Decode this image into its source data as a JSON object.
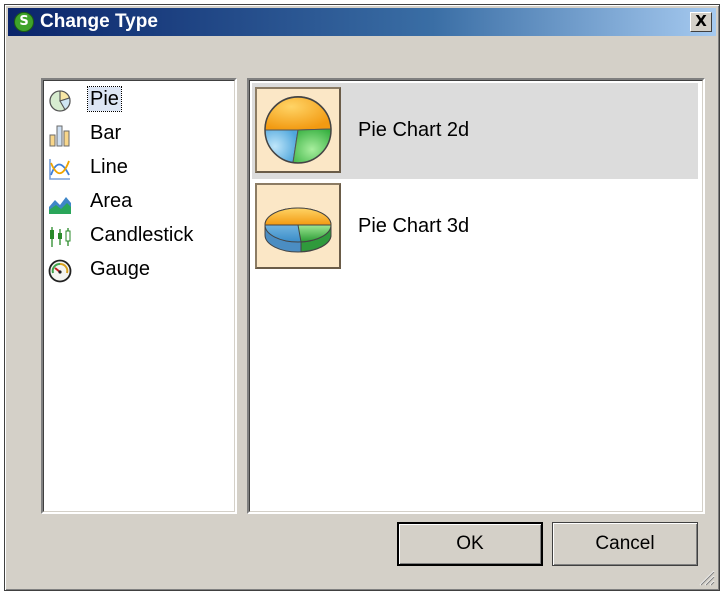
{
  "dialog": {
    "title": "Change Type",
    "close_glyph": "X",
    "app_icon_glyph": "S"
  },
  "chart_types": [
    {
      "label": "Pie",
      "icon": "pie-icon",
      "selected": true
    },
    {
      "label": "Bar",
      "icon": "bar-icon"
    },
    {
      "label": "Line",
      "icon": "line-icon"
    },
    {
      "label": "Area",
      "icon": "area-icon"
    },
    {
      "label": "Candlestick",
      "icon": "candlestick-icon"
    },
    {
      "label": "Gauge",
      "icon": "gauge-icon"
    }
  ],
  "subtypes": [
    {
      "label": "Pie Chart 2d",
      "icon": "pie-2d-icon",
      "highlighted": true
    },
    {
      "label": "Pie Chart 3d",
      "icon": "pie-3d-icon"
    }
  ],
  "buttons": {
    "ok": "OK",
    "cancel": "Cancel"
  },
  "colors": {
    "pie_orange": "#f6b02c",
    "pie_blue": "#74c2ec",
    "pie_green": "#5ed05c",
    "title_bar": "#0a246a"
  }
}
